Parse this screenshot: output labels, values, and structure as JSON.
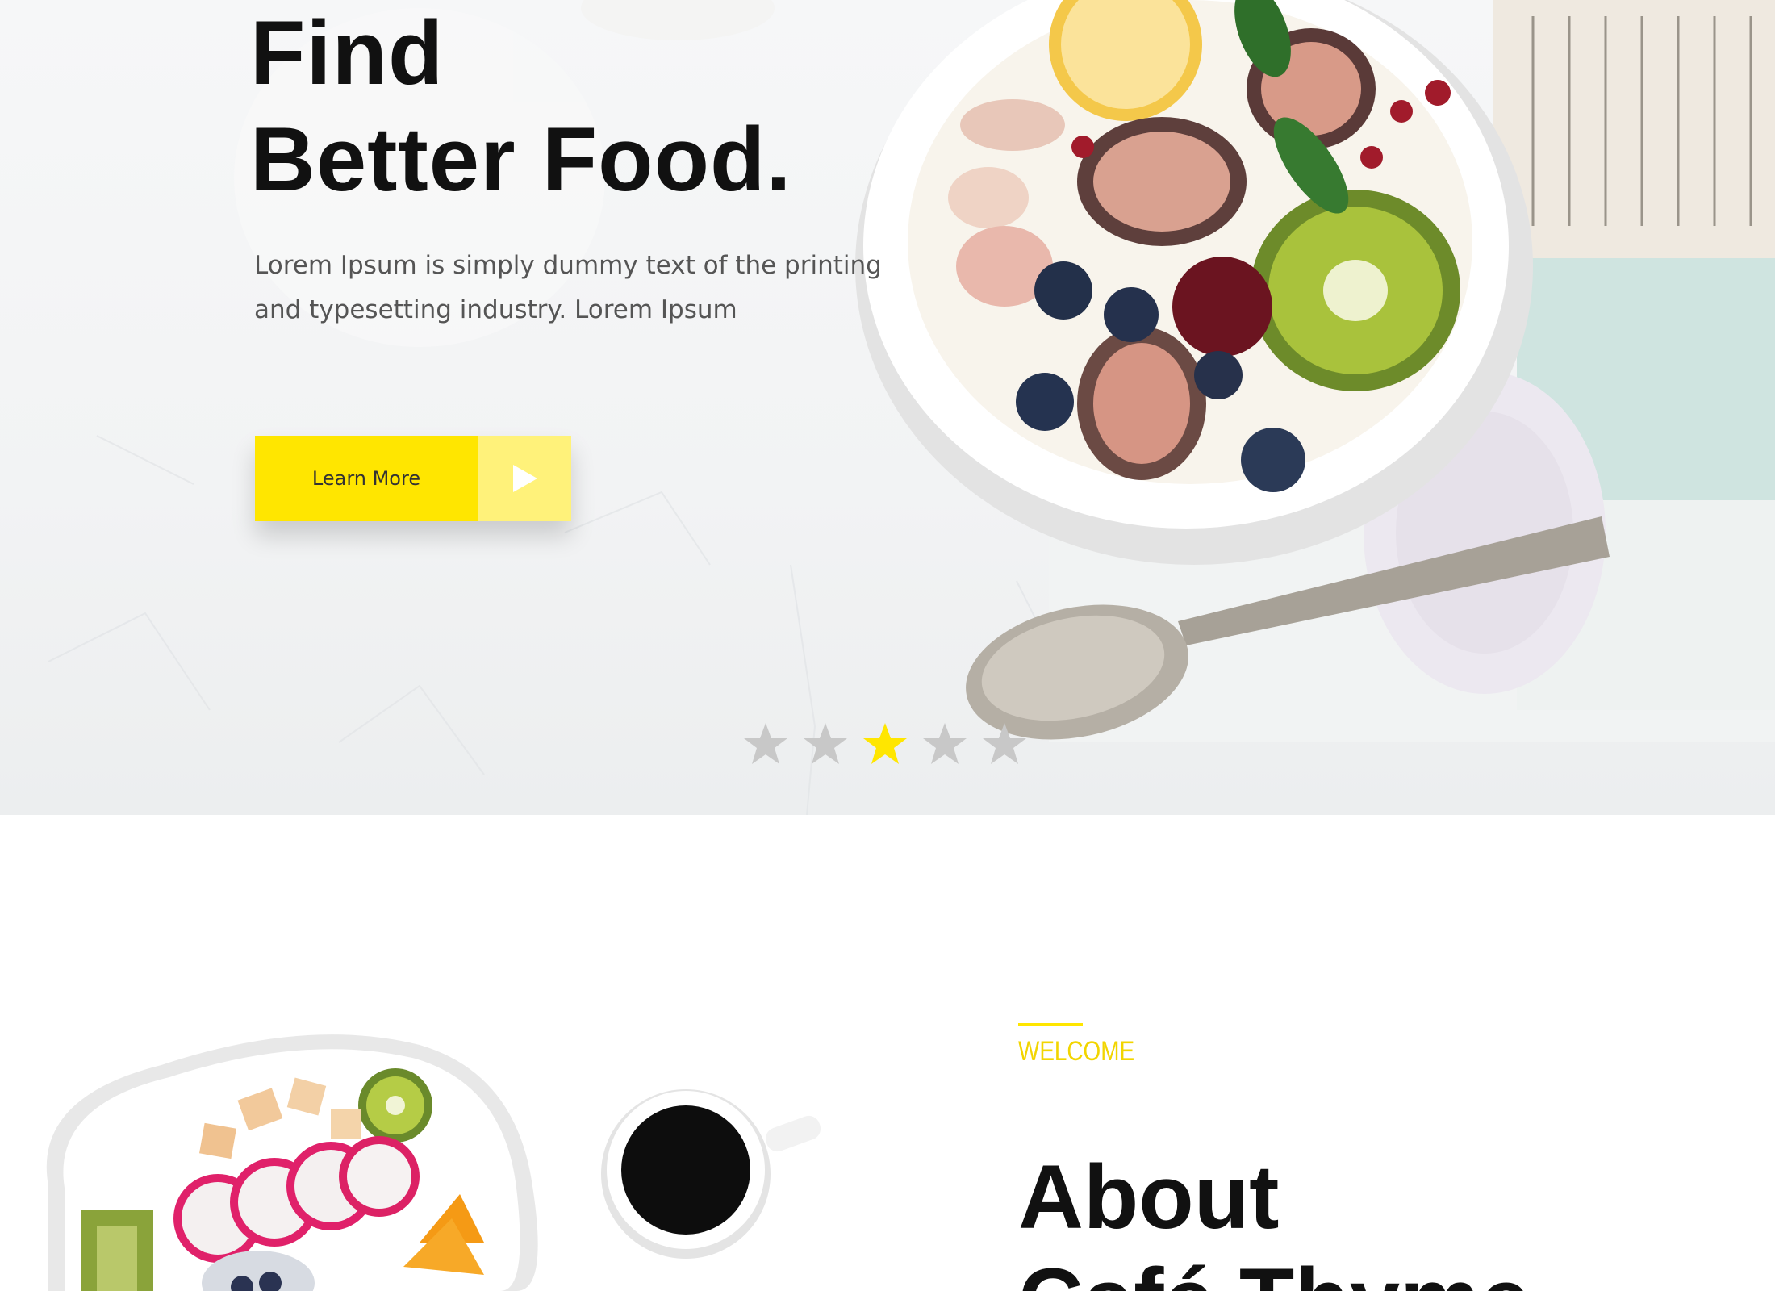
{
  "hero": {
    "title_line1": "Find",
    "title_line2": "Better Food.",
    "description": "Lorem Ipsum is simply dummy text of the printing and typesetting industry. Lorem Ipsum",
    "cta_label": "Learn More",
    "slider": {
      "total": 5,
      "active": 3
    }
  },
  "about": {
    "eyebrow": "WELCOME",
    "title_line1": "About",
    "title_line2": "Café Thyme"
  },
  "colors": {
    "accent": "#ffe600",
    "accent_light": "#fff27a",
    "heading": "#111111",
    "body_text": "#555555",
    "inactive_star": "#c8c8c8"
  },
  "icons": {
    "cta": "play-icon",
    "slider": "star-icon"
  }
}
